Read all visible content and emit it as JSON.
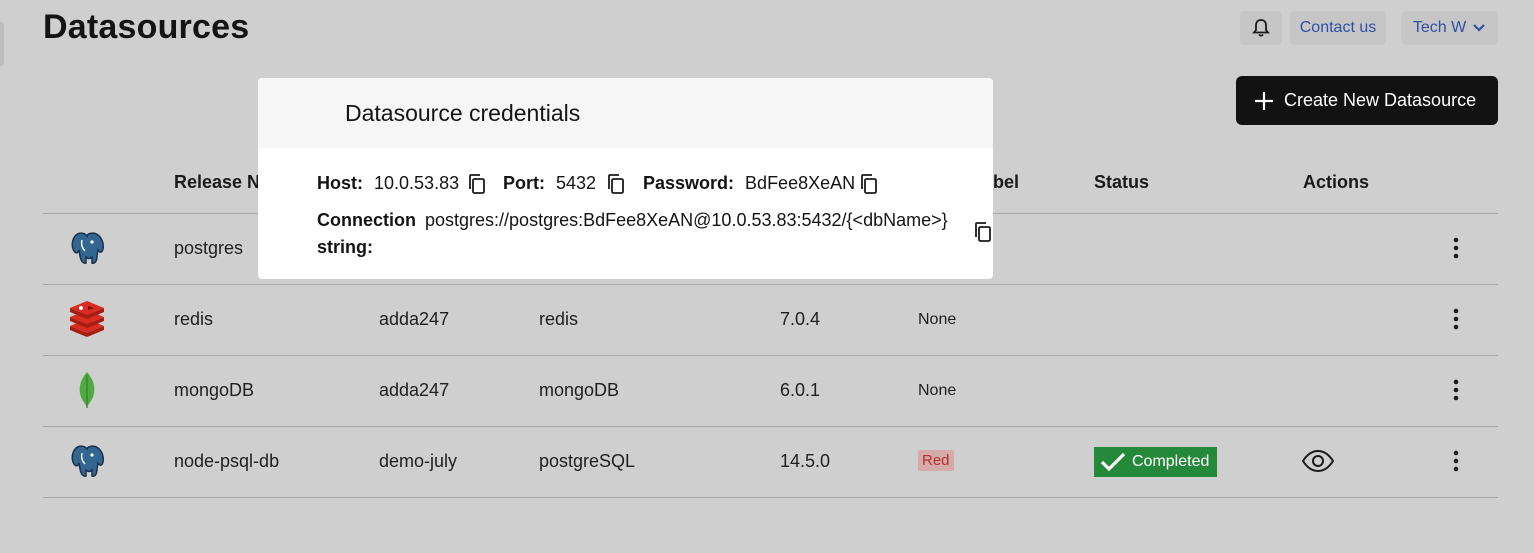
{
  "page": {
    "title": "Datasources"
  },
  "header": {
    "contact_label": "Contact us",
    "org_label": "Tech W"
  },
  "toolbar": {
    "create_label": "Create New Datasource"
  },
  "table": {
    "columns": [
      "Release N",
      "bel",
      "Status",
      "Actions"
    ],
    "rows": [
      {
        "icon": "postgres-elephant-icon",
        "release": "postgres",
        "project": "",
        "type": "",
        "version": "",
        "label": "",
        "status": ""
      },
      {
        "icon": "redis-logo-icon",
        "release": "redis",
        "project": "adda247",
        "type": "redis",
        "version": "7.0.4",
        "label": "None",
        "status": ""
      },
      {
        "icon": "mongodb-leaf-icon",
        "release": "mongoDB",
        "project": "adda247",
        "type": "mongoDB",
        "version": "6.0.1",
        "label": "None",
        "status": ""
      },
      {
        "icon": "postgres-elephant-icon",
        "release": "node-psql-db",
        "project": "demo-july",
        "type": "postgreSQL",
        "version": "14.5.0",
        "label": "Red",
        "status": "Completed"
      }
    ]
  },
  "modal": {
    "title": "Datasource credentials",
    "host_label": "Host:",
    "host_value": "10.0.53.83",
    "port_label": "Port:",
    "port_value": "5432",
    "password_label": "Password:",
    "password_value": "BdFee8XeAN",
    "connection_label_1": "Connection",
    "connection_label_2": "string:",
    "connection_value": "postgres://postgres:BdFee8XeAN@10.0.53.83:5432/{<dbName>}"
  },
  "colors": {
    "accent_link": "#2f4fa8",
    "completed_green": "#25893a",
    "red_badge_bg": "#d7aaaa",
    "red_badge_text": "#b3302c",
    "primary_button": "#121212"
  }
}
